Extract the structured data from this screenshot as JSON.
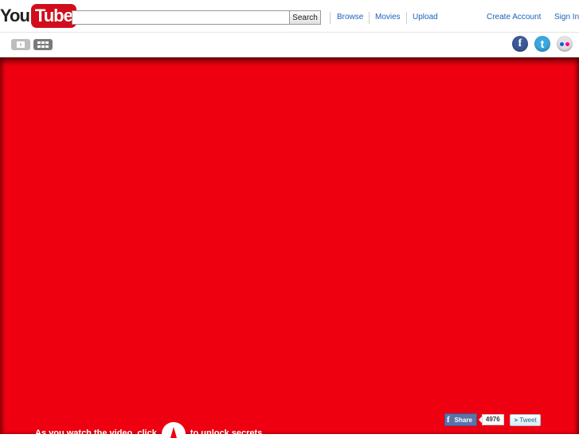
{
  "header": {
    "logo": {
      "you": "You",
      "tube": "Tube"
    },
    "search": {
      "value": "",
      "placeholder": "",
      "button_label": "Search"
    },
    "nav": [
      {
        "label": "Browse"
      },
      {
        "label": "Movies"
      },
      {
        "label": "Upload"
      }
    ],
    "account": {
      "create_label": "Create Account",
      "sign_in_label": "Sign In"
    }
  },
  "toolbar": {
    "view_buttons": [
      "player-view-icon",
      "grid-view-icon"
    ],
    "social": [
      "facebook-icon",
      "twitter-icon",
      "flickr-icon"
    ]
  },
  "stage": {
    "background": "#ee0010",
    "share": {
      "facebook_label": "Share",
      "count": "4976",
      "tweet_label": "Tweet"
    },
    "caption": {
      "before": "As you watch the video, click",
      "after": "to unlock secrets"
    }
  },
  "colors": {
    "brand_red": "#d10c1c",
    "link_blue": "#1c62b9",
    "stage_red": "#ee0010"
  }
}
